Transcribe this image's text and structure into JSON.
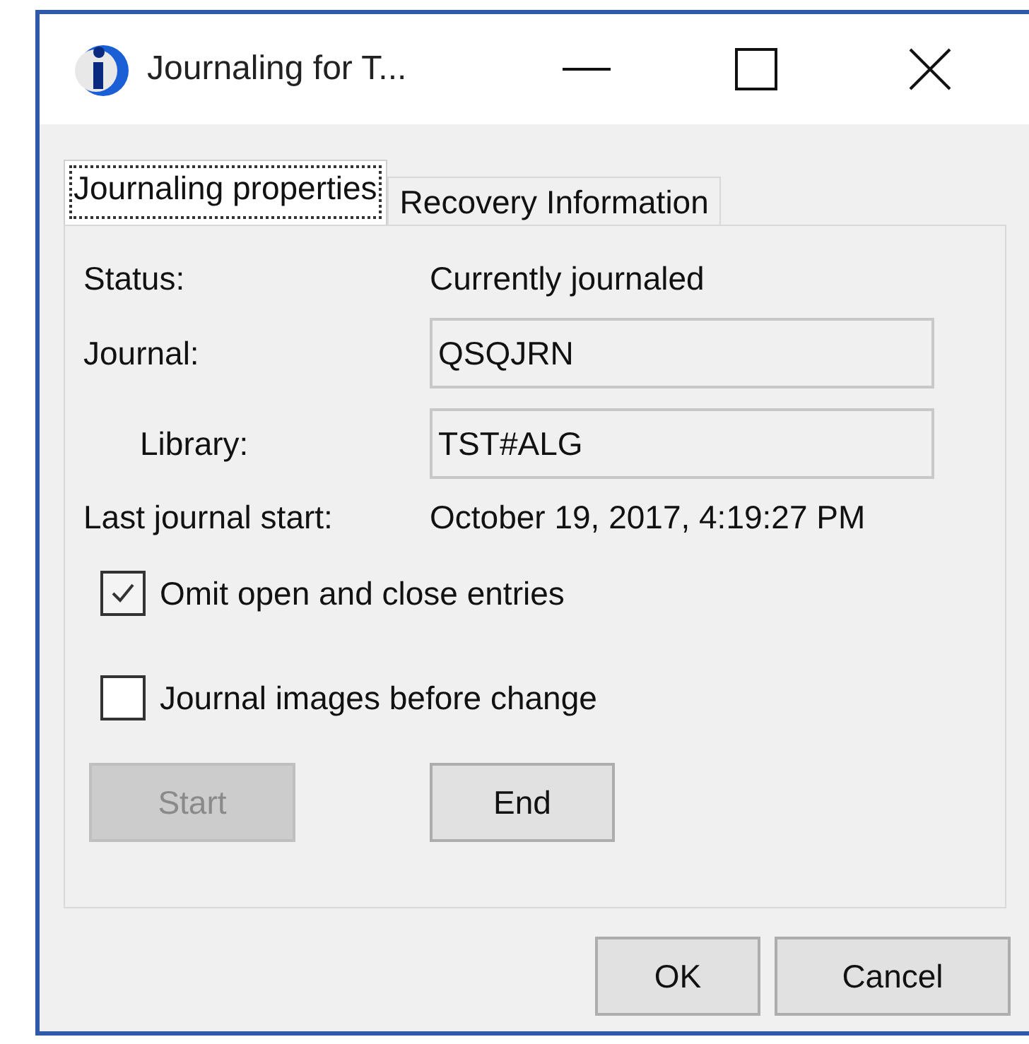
{
  "window": {
    "title": "Journaling for T..."
  },
  "tabs": [
    {
      "label": "Journaling properties",
      "selected": true
    },
    {
      "label": "Recovery Information",
      "selected": false
    }
  ],
  "properties": [
    {
      "kind": "text",
      "label": "Status:",
      "value": "Currently journaled",
      "indented": false
    },
    {
      "kind": "field",
      "label": "Journal:",
      "value": "QSQJRN",
      "indented": false
    },
    {
      "kind": "field",
      "label": "Library:",
      "value": "TST#ALG",
      "indented": true
    },
    {
      "kind": "text",
      "label": "Last journal start:",
      "value": "October 19, 2017, 4:19:27 PM",
      "indented": false
    }
  ],
  "options": [
    {
      "label": "Omit open and close entries",
      "checked": true
    },
    {
      "label": "Journal images before change",
      "checked": false
    }
  ],
  "actions": [
    {
      "label": "Start",
      "disabled": true
    },
    {
      "label": "End",
      "disabled": false
    }
  ],
  "buttons": [
    "OK",
    "Cancel"
  ]
}
